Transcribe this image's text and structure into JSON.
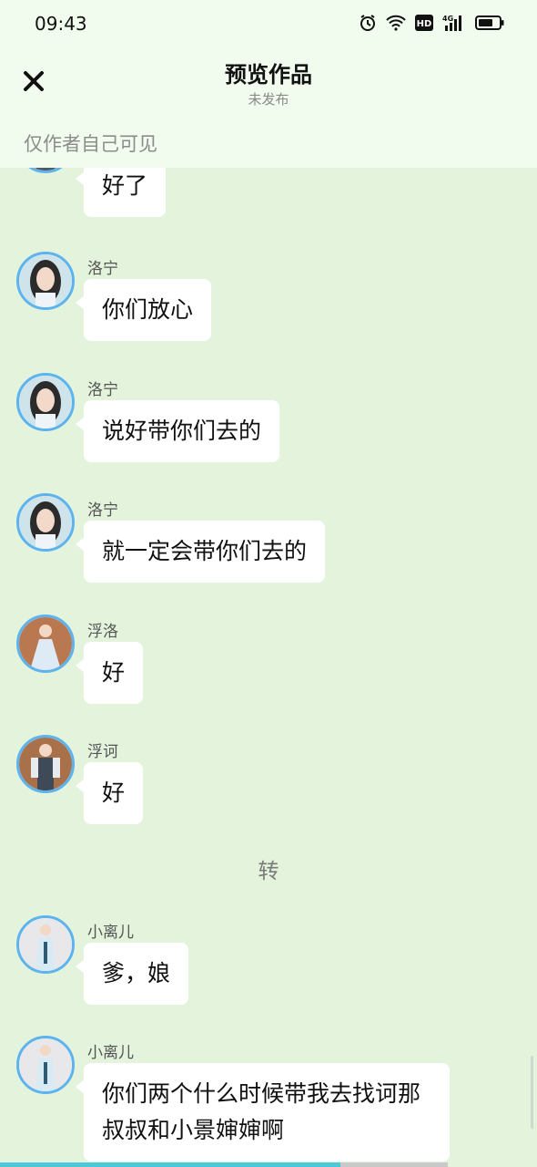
{
  "status_bar": {
    "time": "09:43",
    "icons": [
      "alarm-icon",
      "wifi-icon",
      "hd-icon",
      "4g-signal-icon",
      "battery-icon"
    ]
  },
  "header": {
    "title": "预览作品",
    "subtitle": "未发布",
    "visibility_note": "仅作者自己可见",
    "close_icon": "close-icon"
  },
  "messages": [
    {
      "name": "",
      "text": "好了"
    },
    {
      "name": "洛宁",
      "text": "你们放心"
    },
    {
      "name": "洛宁",
      "text": "说好带你们去的"
    },
    {
      "name": "洛宁",
      "text": "就一定会带你们去的"
    },
    {
      "name": "浮洛",
      "text": "好"
    },
    {
      "name": "浮诃",
      "text": "好"
    },
    {
      "name": "小离儿",
      "text": "爹，娘"
    },
    {
      "name": "小离儿",
      "text": "你们两个什么时候带我去找诃那叔叔和小景婶婶啊"
    }
  ],
  "divider": "转",
  "colors": {
    "background": "#e3f3dc",
    "header_bg": "#f1fbee",
    "avatar_border": "#5cb3ee",
    "progress": "#4cc9d9"
  },
  "progress": 0.76
}
